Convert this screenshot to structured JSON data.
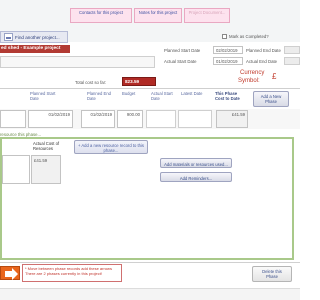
{
  "header": {
    "tab_contacts": "Contacts for this project",
    "tab_notes": "Notes for this project",
    "tab_documents": "Project Document...",
    "find_project": "Find another project...",
    "project_title": "ed shed - Example project",
    "mark_completed": "Mark as Completed?",
    "planned_start_label": "Planned Start Date",
    "planned_start_value": "02/02/2019",
    "planned_end_label": "Planned End Date",
    "actual_start_label": "Actual Start Date",
    "actual_start_value": "01/02/2019",
    "actual_end_label": "Actual End Date",
    "total_cost_label": "Total cost so far:",
    "total_cost_value": "823.59",
    "currency_label": "Currency",
    "currency_symbol_label": "Symbol:",
    "currency_symbol": "£"
  },
  "phase": {
    "col_planned_start": "Planned Start Date",
    "col_planned_end": "Planned End Date",
    "col_budget": "Budget",
    "col_actual_start": "Actual Start Date",
    "col_latest": "Latest Date",
    "col_phase_cost": "This Phase Cost to Date",
    "planned_start": "01/02/2019",
    "planned_end": "01/02/2019",
    "budget": "900.00",
    "phase_cost": "£41.59",
    "add_phase": "Add a New Phase",
    "resources_label": "resource this phase..."
  },
  "resources": {
    "col_actual_cost": "Actual Cost of Resources",
    "actual_cost": "£41.59",
    "add_resource": "+ Add a new resource record to this phase...",
    "add_materials": "Add materials or resources used...",
    "add_reminders": "Add Reminders..."
  },
  "footer": {
    "note": "* Move between phase records add these arrows There are 2 phases currently in this project!",
    "delete_phase": "Delete this Phase"
  }
}
